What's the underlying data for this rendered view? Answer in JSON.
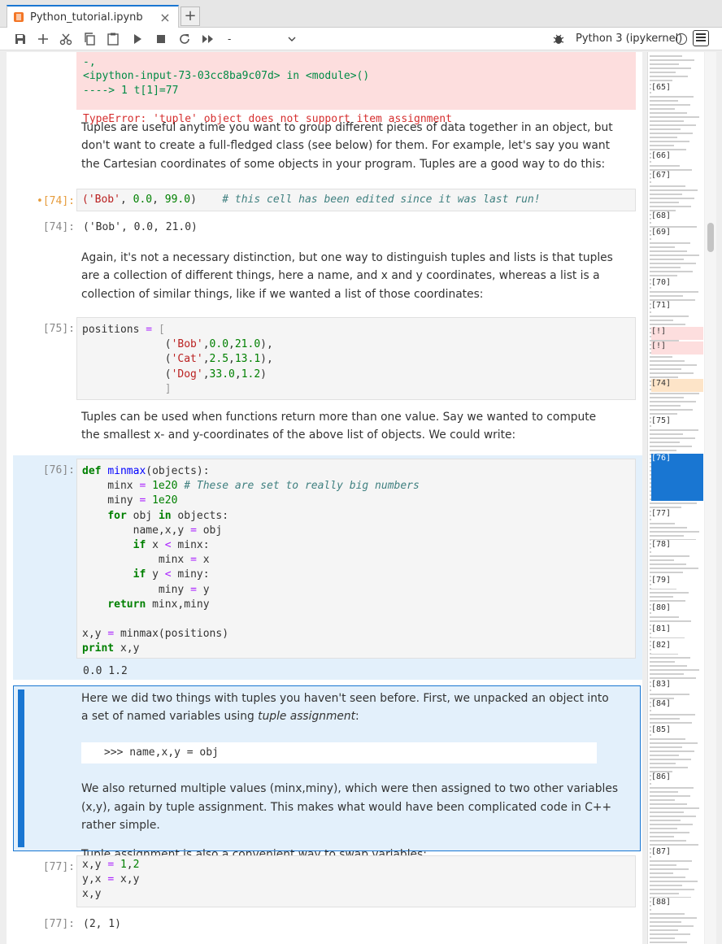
{
  "tab": {
    "title": "Python_tutorial.ipynb",
    "close": "×",
    "add": "+"
  },
  "toolbar": {
    "icons": [
      "save-icon",
      "add-icon",
      "cut-icon",
      "copy-icon",
      "paste-icon",
      "run-icon",
      "stop-icon",
      "restart-icon",
      "fast-forward-icon"
    ],
    "cell_type": "-",
    "kernel": "Python 3 (ipykernel)"
  },
  "error": {
    "line1": "<ipython-input-73-03cc8ba9c07d> in <module>()",
    "line2": "----> 1 t[1]=77",
    "line3": "TypeError: 'tuple' object does not support item assignment"
  },
  "md1": "Tuples are useful anytime you want to group different pieces of data together in an object, but don't want to create a full-fledged class (see below) for them. For example, let's say you want the Cartesian coordinates of some objects in your program. Tuples are a good way to do this:",
  "cell74": {
    "prompt": "•[74]:",
    "code": "('Bob', 0.0, 99.0)",
    "comment": "# this cell has been edited since it was last run!",
    "out_prompt": "[74]:",
    "output": "('Bob', 0.0, 21.0)"
  },
  "md2": "Again, it's not a necessary distinction, but one way to distinguish tuples and lists is that tuples are a collection of different things, here a name, and x and y coordinates, whereas a list is a collection of similar things, like if we wanted a list of those coordinates:",
  "cell75": {
    "prompt": "[75]:"
  },
  "md3": "Tuples can be used when functions return more than one value. Say we wanted to compute the smallest x- and y-coordinates of the above list of objects. We could write:",
  "cell76": {
    "prompt": "[76]:",
    "output": "0.0 1.2"
  },
  "md4": {
    "p1_a": "Here we did two things with tuples you haven't seen before. First, we unpacked an object into a set of named variables using ",
    "p1_em": "tuple assignment",
    "p1_b": ":",
    "code": ">>> name,x,y = obj",
    "p2": "We also returned multiple values (minx,miny), which were then assigned to two other variables (x,y), again by tuple assignment. This makes what would have been complicated code in C++ rather simple.",
    "p3": "Tuple assignment is also a convenient way to swap variables:"
  },
  "cell77": {
    "prompt": "[77]:",
    "out_prompt": "[77]:",
    "output": "(2, 1)"
  },
  "minimap": {
    "prompts": [
      "[65]",
      "[66]",
      "[67]",
      "[68]",
      "[69]",
      "[70]",
      "[71]",
      "[!]",
      "[!]",
      "[74]",
      "[75]",
      "[76]",
      "[77]",
      "[78]",
      "[79]",
      "[80]",
      "[81]",
      "[82]",
      "[83]",
      "[84]",
      "[85]",
      "[86]",
      "[87]",
      "[88]"
    ]
  }
}
